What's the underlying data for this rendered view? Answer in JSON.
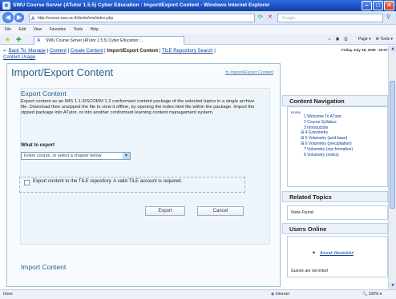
{
  "window": {
    "title": "SWU Course Server (ATutor 1.5.5) Cyber Education : Import/Export Content - Windows Internet Explorer"
  },
  "address": {
    "url": "http://course.swu.ac.th/tools/ims/index.php",
    "search_placeholder": "Google"
  },
  "menu": [
    "File",
    "Edit",
    "View",
    "Favorites",
    "Tools",
    "Help"
  ],
  "tab": {
    "label": "SWU Course Server (ATutor 1.5.5) Cyber Education :..."
  },
  "toolbar": {
    "page": "Page",
    "tools": "Tools"
  },
  "breadcrumb": {
    "back": "Back To: Manage",
    "content": "Content",
    "create": "Create Content",
    "current": "Import/Export Content",
    "tile": "TILE Repository Search",
    "usage": "Content Usage",
    "date": "Friday July 18, 2008 - 20:57"
  },
  "main": {
    "title": "Import/Export Content",
    "header_link": "Import/Export Content",
    "export_heading": "Export Content",
    "export_desc": "Export content as an IMS 1.1.3/SCORM 1.2 conformant content package of the selected topics in a single archive file. Download then unzipped the file to view it offline, by opening the index.html file within the package. Import the zipped package into ATutor, or into another conformant learning content management system.",
    "what_label": "What to export",
    "select_value": "Entire course, or select a chapter below",
    "tile_text": "Export content to the TILE repository. A valid TILE account is required.",
    "export_button": "Export",
    "cancel_button": "Cancel",
    "import_heading": "Import Content"
  },
  "sidebar": {
    "nav_title": "Content Navigation",
    "home": "Home",
    "items": [
      "1 Welcome To ATutor",
      "2 Course Syllabus",
      "3 Introduction",
      "4 Gravimetry",
      "5 Volumetry (acid-base)",
      "6 Volumetry (precipitation)",
      "7 Volumetry (cpx formation)",
      "8 Volumetry (redox)"
    ],
    "related_title": "Related Topics",
    "related_none": "None Found.",
    "users_title": "Users Online",
    "user_name": "Anurak Waralukkul",
    "guests": "Guests are not listed"
  },
  "status": {
    "left": "Done",
    "zone": "Internet",
    "zoom": "100%"
  }
}
